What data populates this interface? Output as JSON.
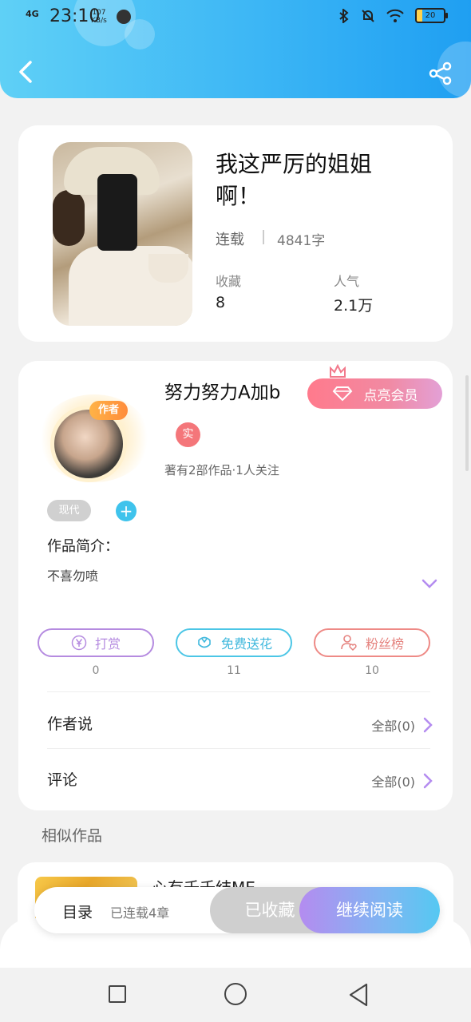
{
  "status_bar": {
    "network": "4G",
    "time": "23:10",
    "speed_value": "107",
    "speed_unit": "KB/s",
    "battery": "20"
  },
  "book": {
    "title": "我这严厉的姐姐啊！",
    "status": "连载",
    "word_count": "4841字",
    "collect_label": "收藏",
    "collect_value": "8",
    "popularity_label": "人气",
    "popularity_value": "2.1万"
  },
  "author": {
    "tag": "作者",
    "name": "努力努力A加b",
    "vip_button": "点亮会员",
    "real_badge": "实",
    "meta": "著有2部作品·1人关注",
    "genre": "现代",
    "add_tag": "+",
    "intro_label": "作品简介：",
    "intro_text": "不喜勿喷"
  },
  "actions": [
    {
      "label": "打赏",
      "count": "0",
      "color": "#b58be0"
    },
    {
      "label": "免费送花",
      "count": "11",
      "color": "#4cc6e6"
    },
    {
      "label": "粉丝榜",
      "count": "10",
      "color": "#ee8a86"
    }
  ],
  "rows": {
    "author_says": "作者说",
    "author_says_right": "全部(0)",
    "comments": "评论",
    "comments_right": "全部(0)"
  },
  "similar": {
    "title": "相似作品",
    "first_name": "心有千千结ME"
  },
  "bottom_bar": {
    "toc": "目录",
    "chapters": "已连载4章",
    "collected": "已收藏",
    "continue": "继续阅读"
  },
  "colors": {
    "accent_blue": "#3cb6f5",
    "accent_purple": "#b48cf0"
  }
}
